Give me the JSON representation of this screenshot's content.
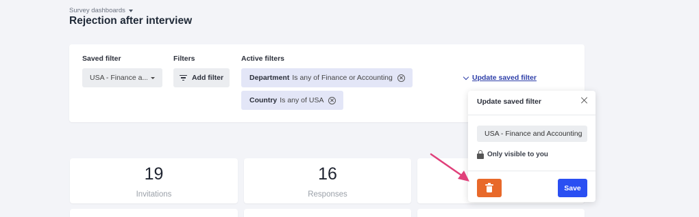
{
  "breadcrumb": {
    "label": "Survey dashboards"
  },
  "page_title": "Rejection after interview",
  "filters": {
    "saved_filter_label": "Saved filter",
    "saved_filter_value": "USA - Finance a...",
    "filters_label": "Filters",
    "add_filter_label": "Add filter",
    "active_filters_label": "Active filters",
    "active": [
      {
        "field": "Department",
        "condition": "Is any of Finance or Accounting"
      },
      {
        "field": "Country",
        "condition": "Is any of USA"
      }
    ],
    "update_link_label": "Update saved filter"
  },
  "stats": [
    {
      "value": "19",
      "label": "Invitations"
    },
    {
      "value": "16",
      "label": "Responses"
    }
  ],
  "popup": {
    "title": "Update saved filter",
    "name_value": "USA - Finance and Accounting",
    "visibility_label": "Only visible to you",
    "save_label": "Save"
  },
  "colors": {
    "accent": "#2a4ff2",
    "delete": "#e8692a",
    "annotation_arrow": "#e0407a",
    "chip_bg": "#e3e6f7"
  },
  "icons": [
    "chevron-down-icon",
    "filter-lines-icon",
    "remove-circle-icon",
    "close-icon",
    "lock-icon",
    "trash-icon"
  ]
}
